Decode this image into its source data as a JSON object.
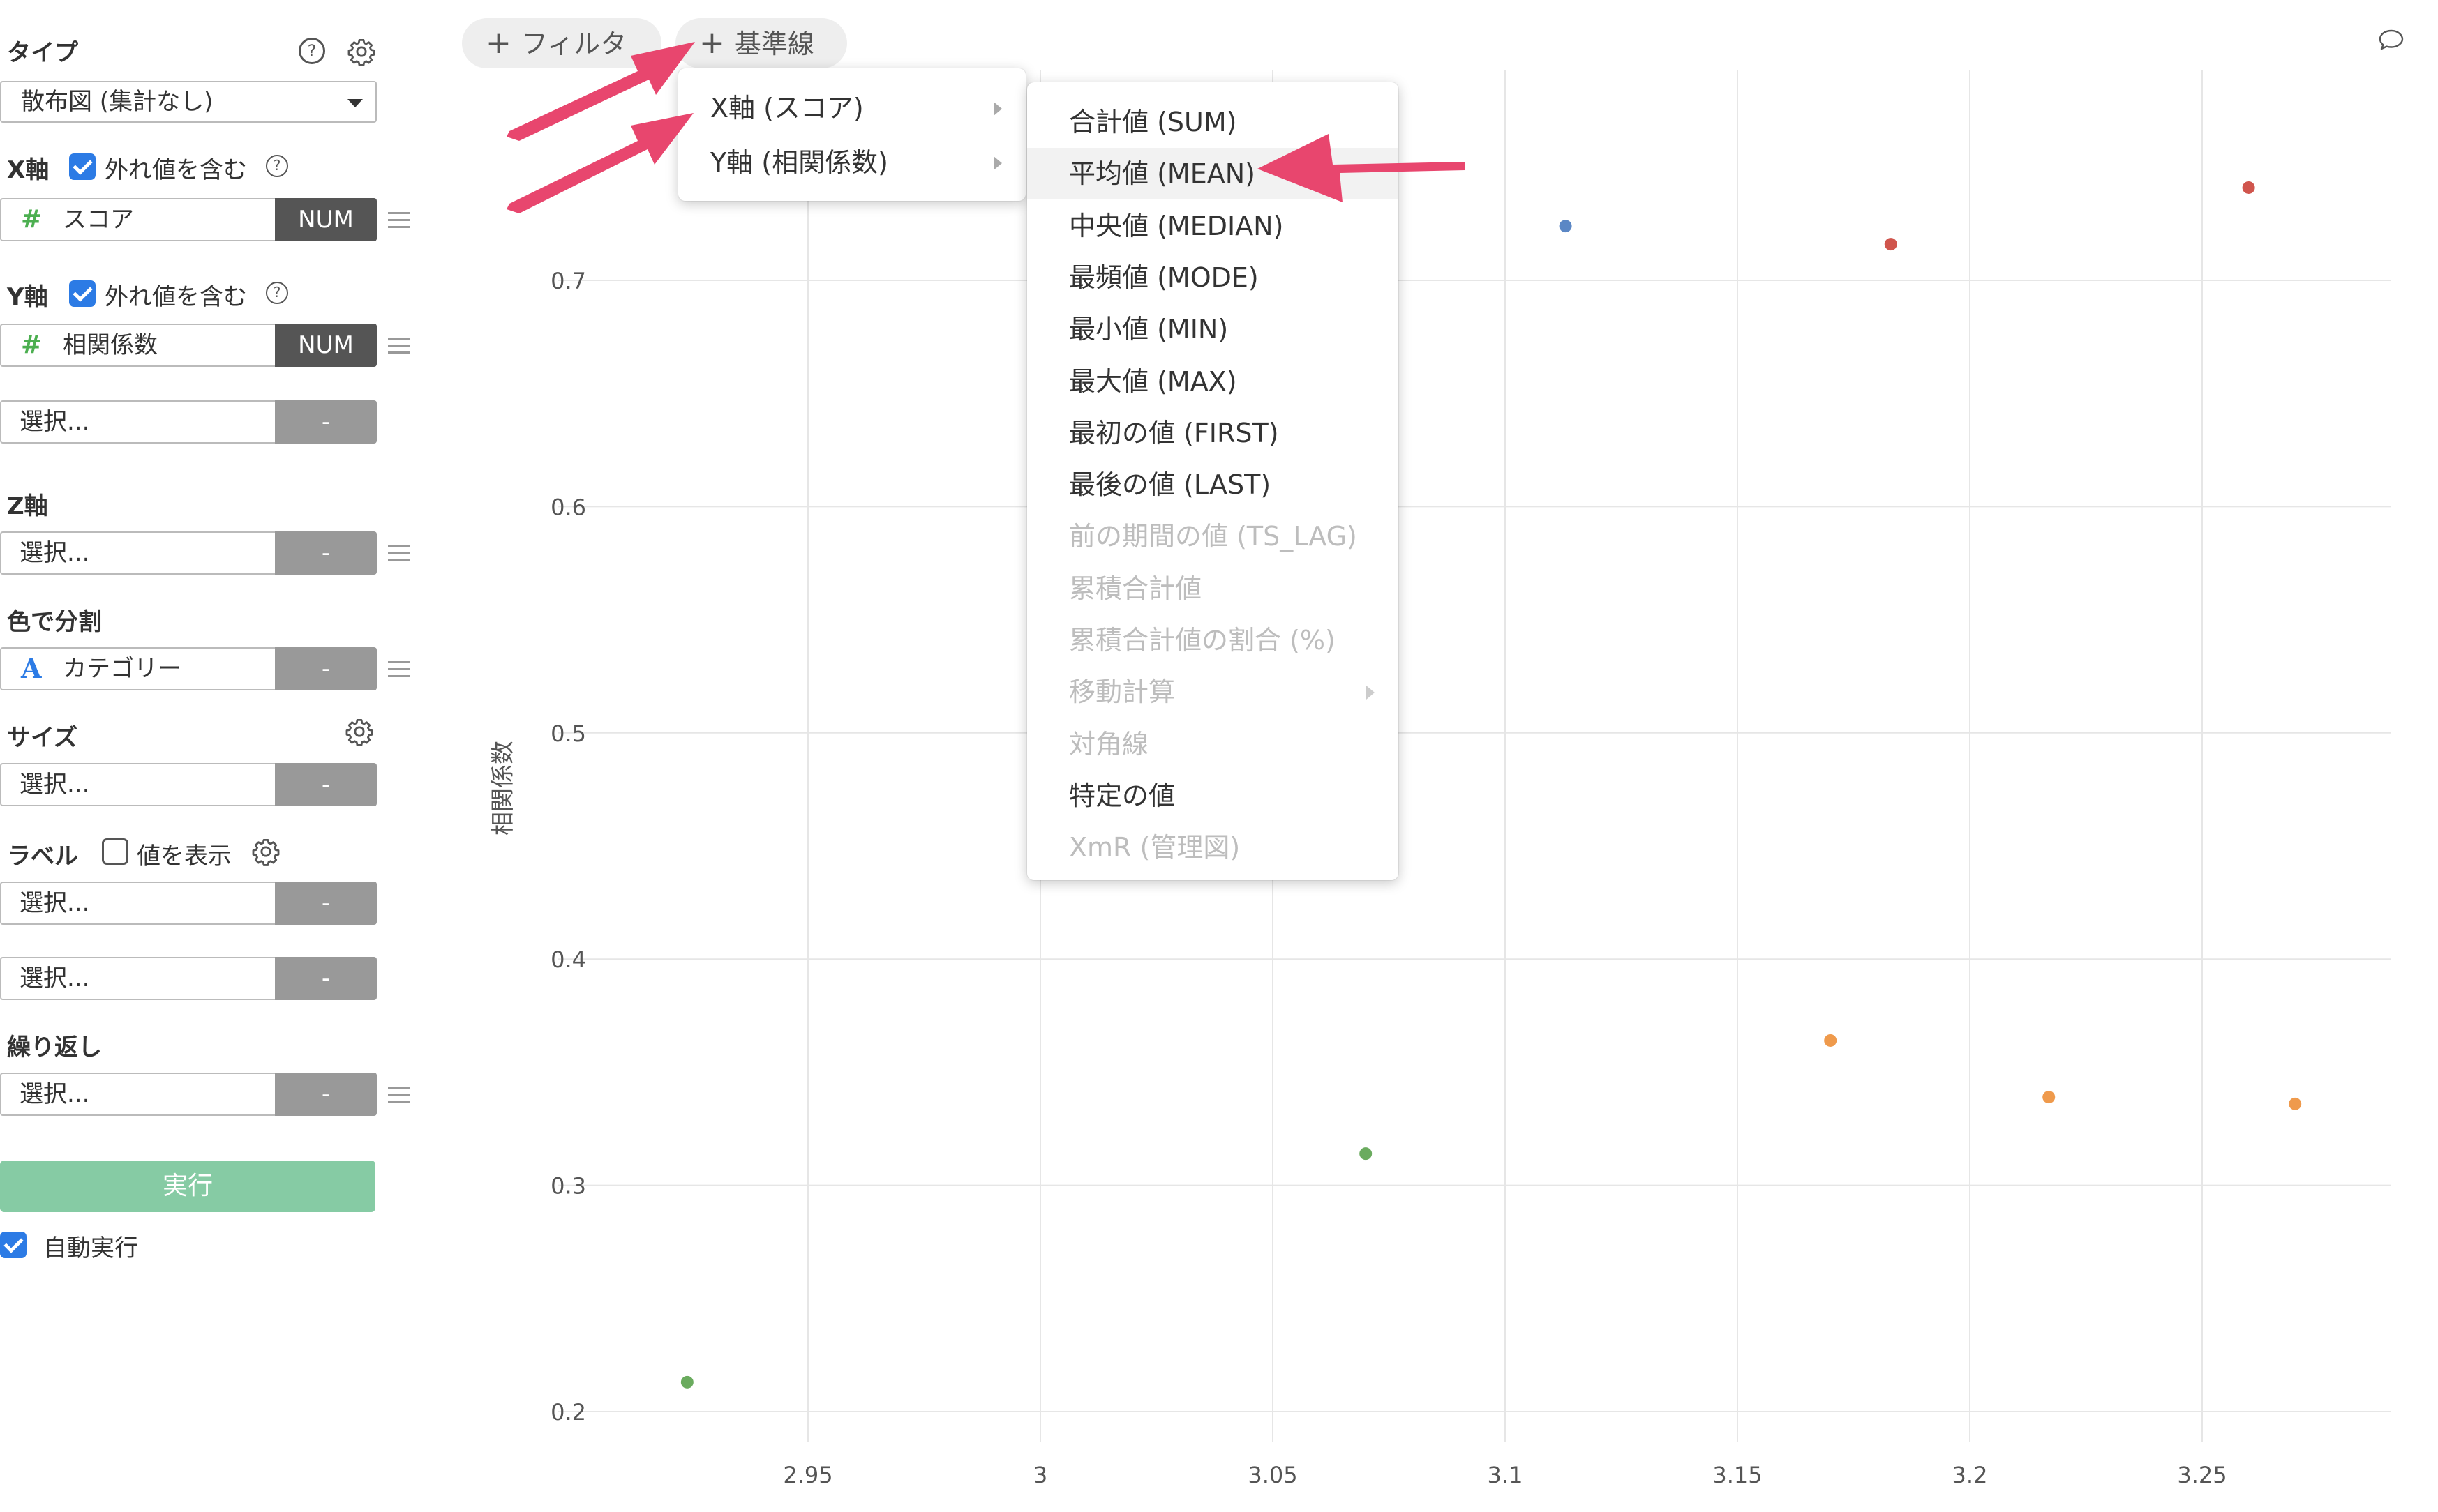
{
  "sidebar": {
    "type": {
      "label": "タイプ",
      "value": "散布図 (集計なし)"
    },
    "x_axis": {
      "label": "X軸",
      "outlier_label": "外れ値を含む",
      "outlier_checked": true,
      "field": "スコア",
      "field_type": "NUM"
    },
    "y_axis": {
      "label": "Y軸",
      "outlier_label": "外れ値を含む",
      "outlier_checked": true,
      "field": "相関係数",
      "field_type": "NUM",
      "extra_placeholder": "選択...",
      "extra_tag": "-"
    },
    "z_axis": {
      "label": "Z軸",
      "placeholder": "選択...",
      "tag": "-"
    },
    "color": {
      "label": "色で分割",
      "field": "カテゴリー",
      "tag": "-"
    },
    "size": {
      "label": "サイズ",
      "placeholder": "選択...",
      "tag": "-"
    },
    "label": {
      "label": "ラベル",
      "show_values_label": "値を表示",
      "show_values_checked": false,
      "placeholder1": "選択...",
      "tag1": "-",
      "placeholder2": "選択...",
      "tag2": "-"
    },
    "repeat": {
      "label": "繰り返し",
      "placeholder": "選択...",
      "tag": "-"
    },
    "run_button": "実行",
    "auto_run": {
      "label": "自動実行",
      "checked": true
    }
  },
  "toolbar": {
    "filter_label": "フィルタ",
    "reference_line_label": "基準線"
  },
  "axis_menu": {
    "items": [
      "X軸 (スコア)",
      "Y軸 (相関係数)"
    ]
  },
  "calc_menu": {
    "items": [
      {
        "label": "合計値 (SUM)",
        "disabled": false
      },
      {
        "label": "平均値 (MEAN)",
        "disabled": false,
        "hover": true
      },
      {
        "label": "中央値 (MEDIAN)",
        "disabled": false
      },
      {
        "label": "最頻値 (MODE)",
        "disabled": false
      },
      {
        "label": "最小値 (MIN)",
        "disabled": false
      },
      {
        "label": "最大値 (MAX)",
        "disabled": false
      },
      {
        "label": "最初の値 (FIRST)",
        "disabled": false
      },
      {
        "label": "最後の値 (LAST)",
        "disabled": false
      },
      {
        "label": "前の期間の値 (TS_LAG)",
        "disabled": true
      },
      {
        "label": "累積合計値",
        "disabled": true
      },
      {
        "label": "累積合計値の割合 (%)",
        "disabled": true
      },
      {
        "label": "移動計算",
        "disabled": true,
        "submenu": true
      },
      {
        "label": "対角線",
        "disabled": true
      },
      {
        "label": "特定の値",
        "disabled": false
      },
      {
        "label": "XmR (管理図)",
        "disabled": true
      }
    ]
  },
  "chart_data": {
    "type": "scatter",
    "ylabel": "相関係数",
    "xlabel": "",
    "x_ticks": [
      "2.95",
      "3",
      "3.05",
      "3.1",
      "3.15",
      "3.2",
      "3.25"
    ],
    "y_ticks": [
      "0.2",
      "0.3",
      "0.4",
      "0.5",
      "0.6",
      "0.7"
    ],
    "xlim": [
      2.9,
      3.29
    ],
    "ylim": [
      0.2,
      0.7
    ],
    "grid": true,
    "points": [
      {
        "x": 2.924,
        "y": 0.213,
        "color": "#6aab5e"
      },
      {
        "x": 3.07,
        "y": 0.314,
        "color": "#6aab5e"
      },
      {
        "x": 3.113,
        "y": 0.724,
        "color": "#5b87c5"
      },
      {
        "x": 3.17,
        "y": 0.364,
        "color": "#ef9a4c"
      },
      {
        "x": 3.183,
        "y": 0.716,
        "color": "#d0554d"
      },
      {
        "x": 3.217,
        "y": 0.339,
        "color": "#ef9a4c"
      },
      {
        "x": 3.26,
        "y": 0.741,
        "color": "#d0554d"
      },
      {
        "x": 3.27,
        "y": 0.336,
        "color": "#ef9a4c"
      }
    ]
  },
  "colors": {
    "annotation_arrow": "#e8466e",
    "run_button": "#86cba4",
    "accent": "#2c7be5"
  }
}
